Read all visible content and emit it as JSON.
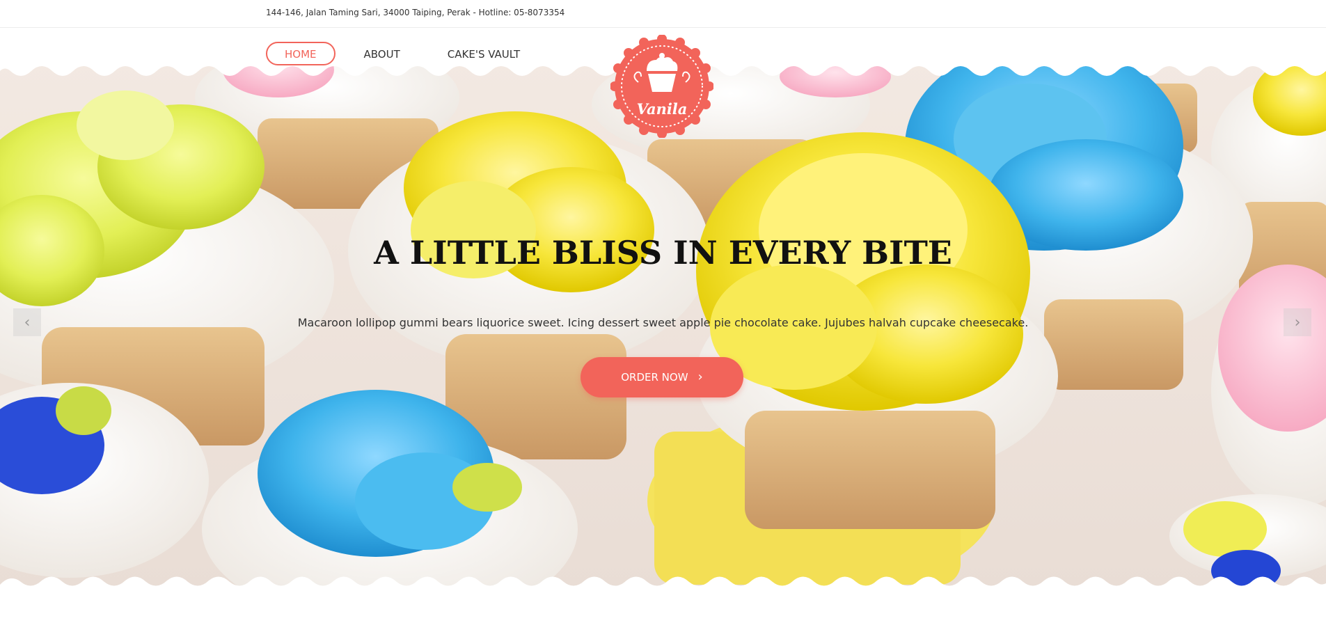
{
  "topbar": {
    "address": "144-146, Jalan Taming Sari, 34000 Taiping, Perak - Hotline: 05-8073354"
  },
  "nav": {
    "items": [
      {
        "label": "HOME",
        "active": true
      },
      {
        "label": "ABOUT",
        "active": false
      },
      {
        "label": "CAKE'S VAULT",
        "active": false
      }
    ]
  },
  "logo": {
    "text": "Vanila",
    "icon": "cupcake-icon"
  },
  "hero": {
    "headline": "A LITTLE BLISS IN EVERY BITE",
    "subline": "Macaroon lollipop gummi bears liquorice sweet. Icing dessert sweet apple pie chocolate cake. Jujubes halvah cupcake cheesecake.",
    "cta_label": "ORDER NOW",
    "cta_icon": "chevron-right-icon",
    "prev_icon": "chevron-left-icon",
    "next_icon": "chevron-right-icon"
  },
  "colors": {
    "accent": "#f2645a",
    "text": "#333333"
  }
}
